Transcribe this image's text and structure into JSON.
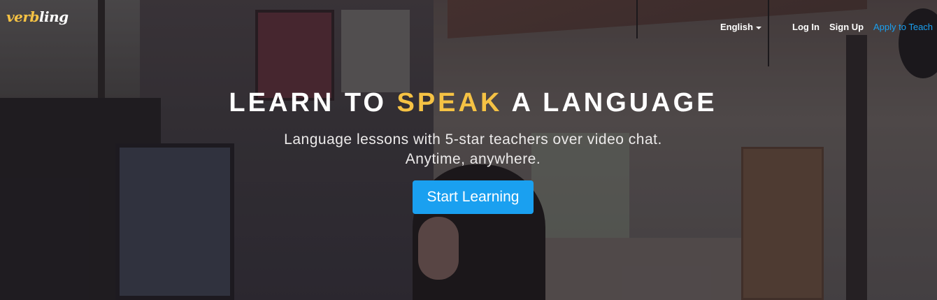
{
  "brand": {
    "logo_accent": "verb",
    "logo_rest": "ling"
  },
  "nav": {
    "language": "English",
    "login": "Log In",
    "signup": "Sign Up",
    "apply_teach": "Apply to Teach"
  },
  "hero": {
    "headline_part1": "LEARN TO ",
    "headline_accent": "SPEAK",
    "headline_part2": " A LANGUAGE",
    "subtitle_line1": "Language lessons with 5-star teachers over video chat.",
    "subtitle_line2": "Anytime, anywhere.",
    "cta_label": "Start Learning"
  },
  "colors": {
    "accent_yellow": "#f5c244",
    "primary_blue": "#1aa0f0",
    "text_white": "#ffffff"
  },
  "icons": {
    "language_dropdown": "chevron-down-icon"
  }
}
